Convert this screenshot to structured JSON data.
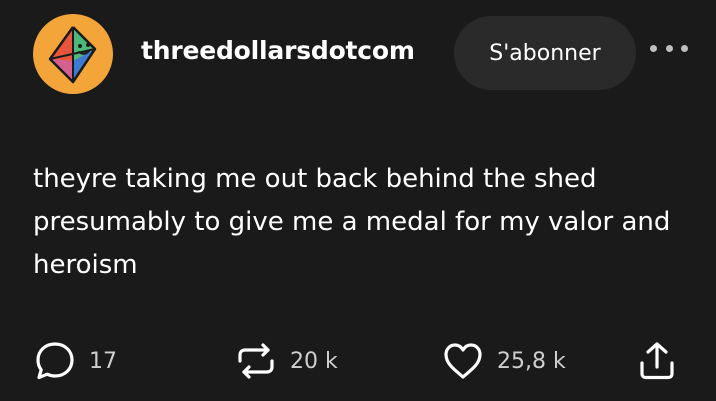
{
  "post": {
    "author": "threedollarsdotcom",
    "follow_label": "S'abonner",
    "text": "theyre taking me out back behind the shed presumably to give me a medal for my valor and heroism"
  },
  "actions": {
    "replies": "17",
    "reblogs": "20 k",
    "likes": "25,8 k"
  },
  "icons": {
    "avatar": "colorful-octahedron-face-avatar",
    "more": "more-dots-icon",
    "reply": "comment-bubble-icon",
    "reblog": "repost-arrows-icon",
    "like": "heart-icon",
    "share": "share-upload-icon"
  },
  "colors": {
    "background": "#1a1a1a",
    "avatar_bg": "#f3a53a",
    "button_bg": "#2a2a2a"
  }
}
